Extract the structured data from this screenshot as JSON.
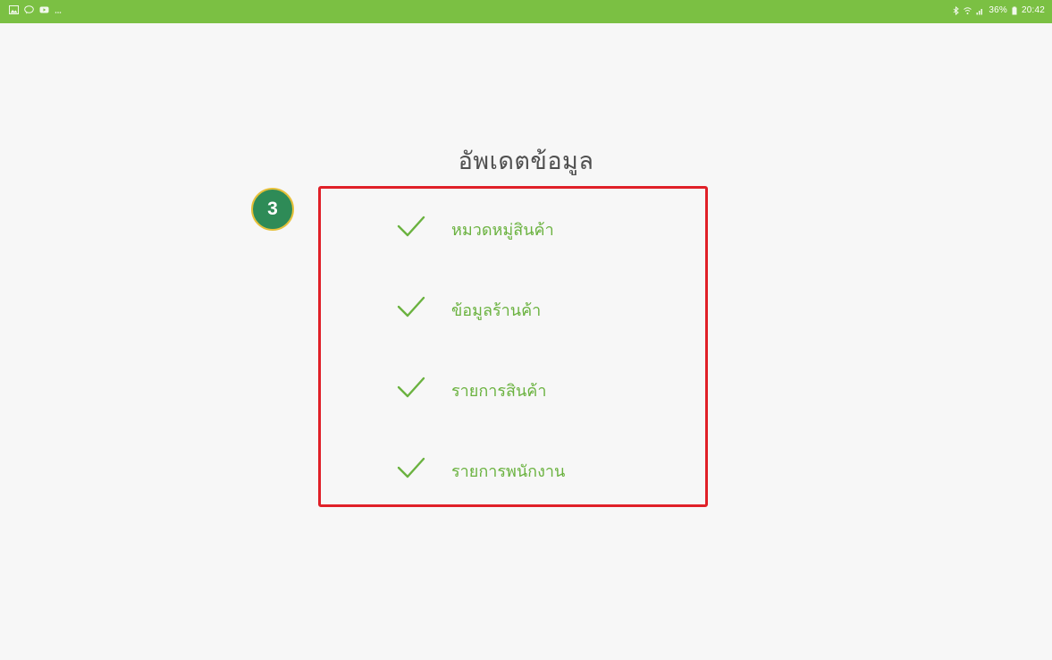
{
  "status_bar": {
    "left_icons": [
      "gallery-icon",
      "chat-icon",
      "youtube-icon"
    ],
    "right_text": "36%",
    "time": "20:42",
    "color": "#7bc043"
  },
  "title": "อัพเดตข้อมูล",
  "step_badge": "3",
  "items": [
    {
      "label": "หมวดหมู่สินค้า",
      "icon": "check-icon"
    },
    {
      "label": "ข้อมูลร้านค้า",
      "icon": "check-icon"
    },
    {
      "label": "รายการสินค้า",
      "icon": "check-icon"
    },
    {
      "label": "รายการพนักงาน",
      "icon": "check-icon"
    }
  ],
  "colors": {
    "accent_green": "#6ab23f",
    "highlight_red": "#e02028",
    "badge_green": "#2e8b57"
  }
}
